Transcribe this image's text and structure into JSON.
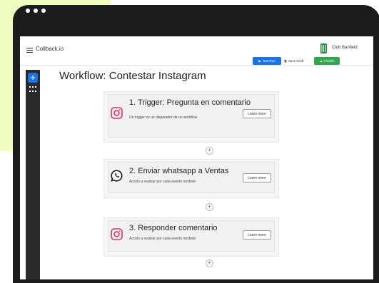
{
  "app": {
    "title": "Collback.io",
    "org_name": "Club Banfield"
  },
  "workflow": {
    "title": "Workflow: Contestar Instagram",
    "actions": {
      "test_run": "Test Run",
      "save_draft": "Save Draft",
      "publish": "Publish"
    }
  },
  "steps": [
    {
      "title": "1. Trigger: Pregunta en comentario",
      "description": "Un trigger es un disparador de un workflow",
      "icon": "instagram-icon",
      "button": "Learn more"
    },
    {
      "title": "2. Enviar whatsapp a Ventas",
      "description": "Acción a realizar por cada evento recibido",
      "icon": "whatsapp-icon",
      "button": "Learn more"
    },
    {
      "title": "3. Responder comentario",
      "description": "Acción a realizar por cada evento recibido",
      "icon": "instagram-icon",
      "button": "Learn more"
    }
  ],
  "add_step_symbol": "+",
  "sidebar": {
    "add_symbol": "+",
    "apps_icon": "apps-grid-icon"
  },
  "colors": {
    "accent_blue": "#1a73e8",
    "publish_green": "#2fa84f",
    "instagram": "#e1306c",
    "background_green": "#eefcc0",
    "frame": "#1c1c1c"
  }
}
